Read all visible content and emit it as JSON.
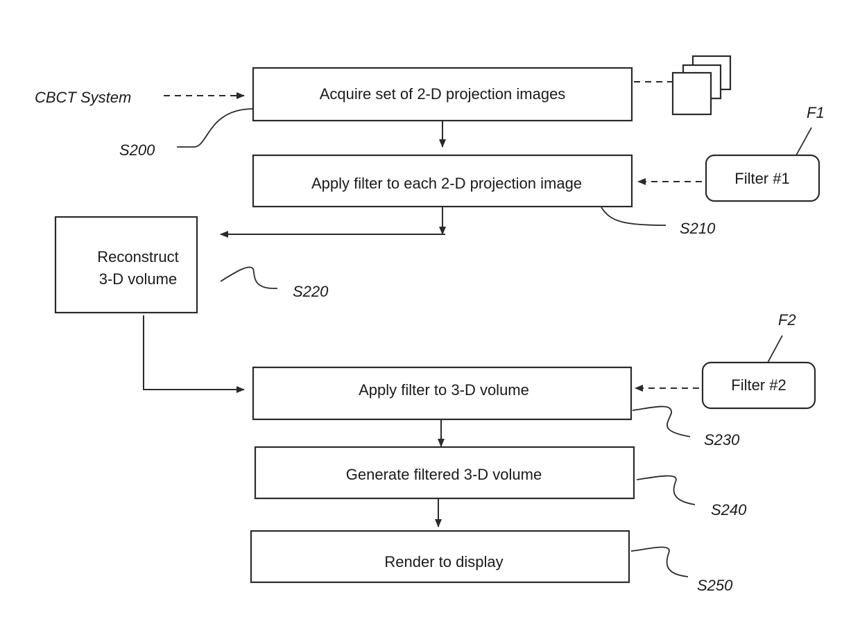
{
  "diagram": {
    "type": "flowchart",
    "source": {
      "label": "CBCT System"
    },
    "steps": [
      {
        "id": "S200",
        "label": "Acquire set of 2-D projection images"
      },
      {
        "id": "S210",
        "label": "Apply filter to each 2-D projection image"
      },
      {
        "id": "S220",
        "label_line1": "Reconstruct",
        "label_line2": "3-D volume"
      },
      {
        "id": "S230",
        "label": "Apply filter to 3-D volume"
      },
      {
        "id": "S240",
        "label": "Generate filtered 3-D volume"
      },
      {
        "id": "S250",
        "label": "Render to display"
      }
    ],
    "filters": [
      {
        "id": "F1",
        "label": "Filter #1",
        "applies_to": "S210"
      },
      {
        "id": "F2",
        "label": "Filter #2",
        "applies_to": "S230"
      }
    ],
    "edges": [
      {
        "from": "CBCT System",
        "to": "S200",
        "style": "dashed"
      },
      {
        "from": "S200",
        "to": "projection-images-stack",
        "style": "dashed"
      },
      {
        "from": "S200",
        "to": "S210",
        "style": "solid"
      },
      {
        "from": "F1",
        "to": "S210",
        "style": "dashed"
      },
      {
        "from": "S210",
        "to": "S220",
        "style": "solid"
      },
      {
        "from": "S220",
        "to": "S230",
        "style": "solid"
      },
      {
        "from": "F2",
        "to": "S230",
        "style": "dashed"
      },
      {
        "from": "S230",
        "to": "S240",
        "style": "solid"
      },
      {
        "from": "S240",
        "to": "S250",
        "style": "solid"
      }
    ]
  }
}
